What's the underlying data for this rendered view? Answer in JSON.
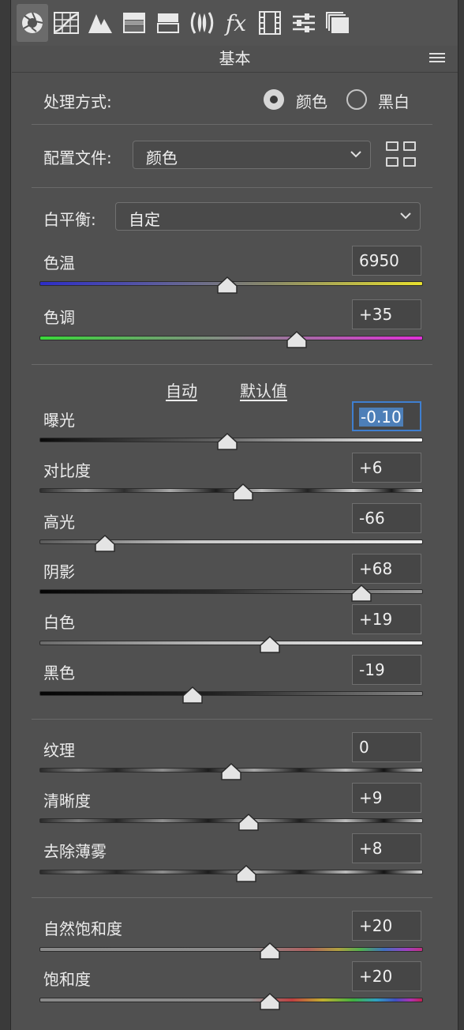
{
  "header": {
    "title": "基本"
  },
  "toolbar": {
    "tools": [
      "aperture-icon",
      "tone-curve-icon",
      "detail-icon",
      "hsl-icon",
      "split-toning-icon",
      "lens-icon",
      "effects-icon",
      "calibration-icon",
      "presets-icon",
      "snapshots-icon"
    ],
    "effects_label": "fx"
  },
  "treatment": {
    "label": "处理方式:",
    "options": [
      "颜色",
      "黑白"
    ],
    "selected": "颜色"
  },
  "profile": {
    "label": "配置文件:",
    "value": "颜色"
  },
  "white_balance": {
    "label": "白平衡:",
    "value": "自定"
  },
  "buttons": {
    "auto": "自动",
    "default": "默认值"
  },
  "sliders": [
    {
      "key": "temp",
      "label": "色温",
      "value": "6950",
      "position": 0.49
    },
    {
      "key": "tint",
      "label": "色调",
      "value": "+35",
      "position": 0.67
    },
    {
      "key": "exposure",
      "label": "曝光",
      "value": "-0.10",
      "position": 0.49
    },
    {
      "key": "contrast",
      "label": "对比度",
      "value": "+6",
      "position": 0.53
    },
    {
      "key": "highlights",
      "label": "高光",
      "value": "-66",
      "position": 0.17
    },
    {
      "key": "shadows",
      "label": "阴影",
      "value": "+68",
      "position": 0.84
    },
    {
      "key": "whites",
      "label": "白色",
      "value": "+19",
      "position": 0.6
    },
    {
      "key": "blacks",
      "label": "黑色",
      "value": "-19",
      "position": 0.4
    },
    {
      "key": "texture",
      "label": "纹理",
      "value": "0",
      "position": 0.5
    },
    {
      "key": "clarity",
      "label": "清晰度",
      "value": "+9",
      "position": 0.545
    },
    {
      "key": "dehaze",
      "label": "去除薄雾",
      "value": "+8",
      "position": 0.54
    },
    {
      "key": "vibrance",
      "label": "自然饱和度",
      "value": "+20",
      "position": 0.6
    },
    {
      "key": "saturation",
      "label": "饱和度",
      "value": "+20",
      "position": 0.6
    }
  ]
}
